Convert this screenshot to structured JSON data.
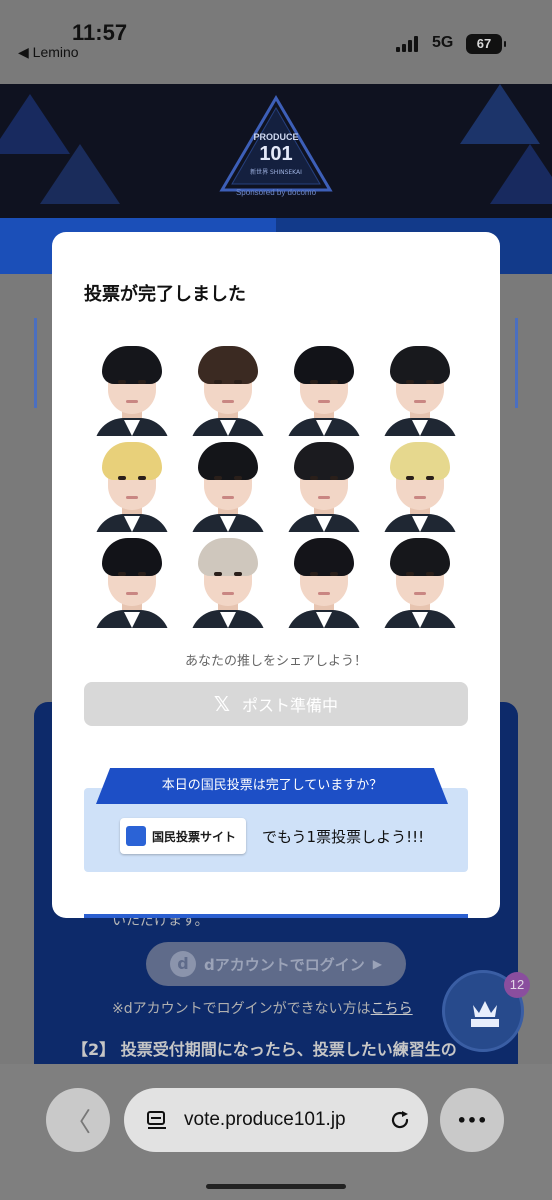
{
  "status_bar": {
    "time": "11:57",
    "back_app": "◀ Lemino",
    "network": "5G",
    "battery": "67"
  },
  "banner": {
    "logo_line1": "PRODUCE",
    "logo_line2": "101",
    "logo_line3": "新世界 SHINSEKAI",
    "sponsor": "Sponsored by docomo",
    "brand_color": "#0f1220"
  },
  "modal": {
    "title": "投票が完了しました",
    "share_prompt": "あなたの推しをシェアしよう！",
    "post_button": "ポスト準備中",
    "promo_heading": "本日の国民投票は完了していますか？",
    "promo_button": "国民投票サイト",
    "promo_tail": "でもう1票投票しよう!!!",
    "portraits": [
      {
        "hair": "#15161b"
      },
      {
        "hair": "#3b2a22"
      },
      {
        "hair": "#121318"
      },
      {
        "hair": "#18191d"
      },
      {
        "hair": "#e8d07a"
      },
      {
        "hair": "#141519"
      },
      {
        "hair": "#1b1b1f"
      },
      {
        "hair": "#e6d88e"
      },
      {
        "hair": "#121318"
      },
      {
        "hair": "#cfc7bd"
      },
      {
        "hair": "#141419"
      },
      {
        "hair": "#16171b"
      }
    ]
  },
  "background": {
    "partial_text": "いただけます。",
    "login_button": "dアカウントでログイン",
    "login_note": "※dアカウントでログインができない方は",
    "login_note_link": "こちら",
    "step_text": "【2】 投票受付期間になったら、投票したい練習生の",
    "vote_count": "12"
  },
  "browser": {
    "url": "vote.produce101.jp",
    "back_glyph": "〈",
    "more_glyph": "•••"
  }
}
